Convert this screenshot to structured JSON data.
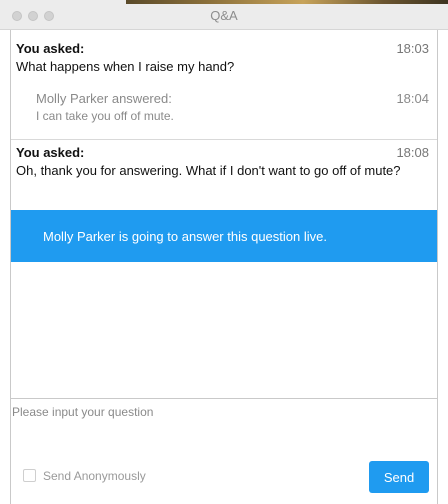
{
  "window": {
    "title": "Q&A"
  },
  "questions": [
    {
      "label": "You asked:",
      "time": "18:03",
      "text": "What happens when I raise my hand?",
      "answer": {
        "by": "Molly Parker answered:",
        "time": "18:04",
        "text": "I can take you off of mute."
      }
    },
    {
      "label": "You asked:",
      "time": "18:08",
      "text": "Oh, thank you for answering. What if I don't want to go off of mute?",
      "status": "Molly Parker is going to answer this question live."
    }
  ],
  "input": {
    "placeholder": "Please input your question",
    "value": ""
  },
  "footer": {
    "anonymous_label": "Send Anonymously",
    "anonymous_checked": false,
    "send_label": "Send"
  },
  "colors": {
    "accent": "#1f9bf0",
    "muted_text": "#8a8a8a",
    "titlebar": "#ececec"
  },
  "icons": {
    "window_controls": [
      "close-dot",
      "minimize-dot",
      "zoom-dot"
    ]
  }
}
